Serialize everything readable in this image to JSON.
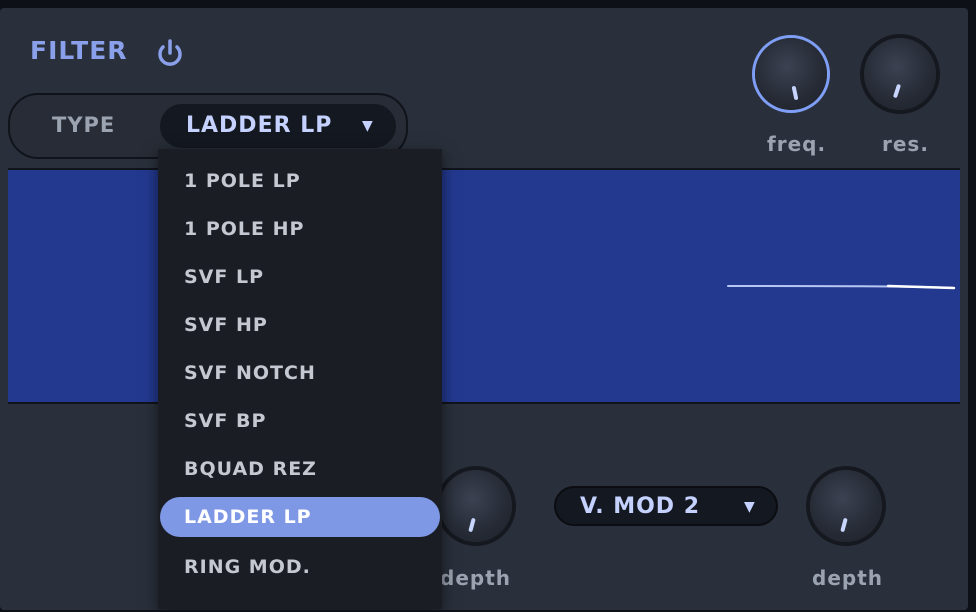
{
  "header": {
    "title": "FILTER",
    "power_icon": "power-icon"
  },
  "type_selector": {
    "label": "TYPE",
    "value": "LADDER LP",
    "caret": "▼"
  },
  "knobs": {
    "freq": {
      "label": "freq."
    },
    "res": {
      "label": "res."
    },
    "depth_left": {
      "label": "depth"
    },
    "depth_right": {
      "label": "depth"
    }
  },
  "mod_selector": {
    "value": "V. MOD 2",
    "caret": "▼"
  },
  "dropdown": {
    "items": [
      "1 POLE LP",
      "1 POLE HP",
      "SVF LP",
      "SVF HP",
      "SVF NOTCH",
      "SVF BP",
      "BQUAD REZ",
      "LADDER LP",
      "RING MOD."
    ],
    "selected": "LADDER LP"
  },
  "colors": {
    "accent": "#8aa0ea",
    "panel": "#2a303b",
    "display": "#233990",
    "selected_item": "#7f98e6"
  }
}
